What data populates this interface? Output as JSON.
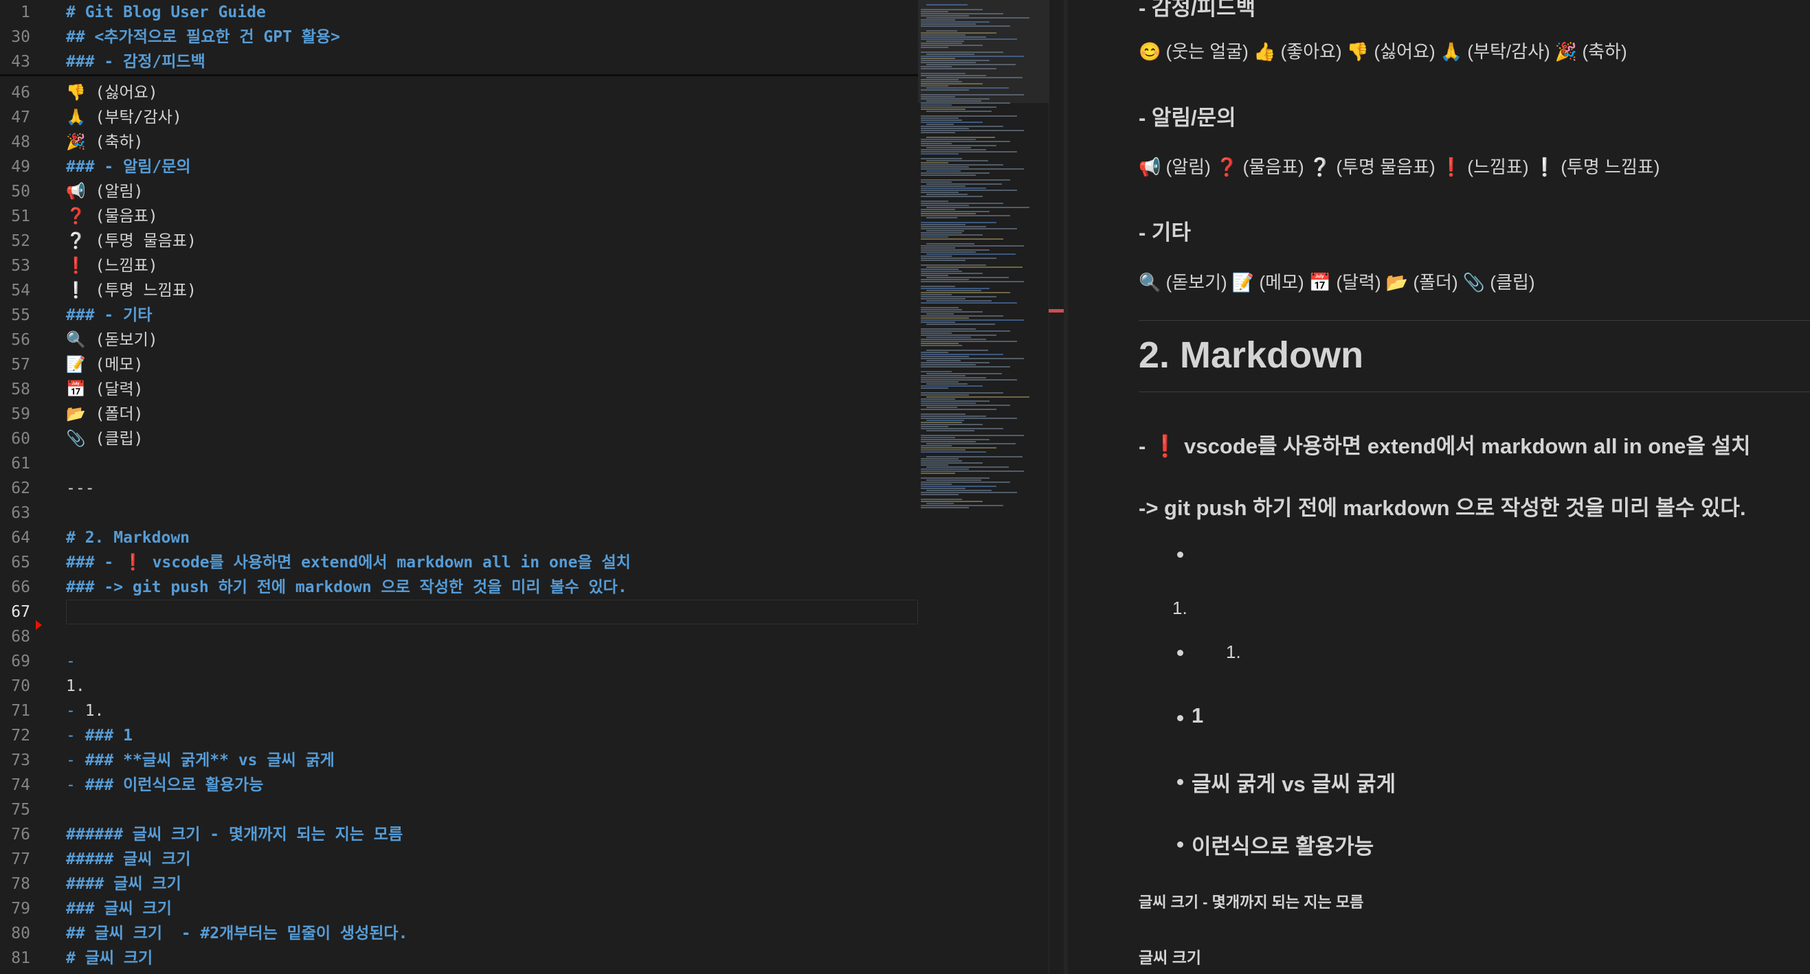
{
  "editor": {
    "sticky_lines": [
      {
        "num": "1",
        "text": "# Git Blog User Guide"
      },
      {
        "num": "30",
        "text": "## <추가적으로 필요한 건 GPT 활용>"
      },
      {
        "num": "43",
        "text": "### - 감정/피드백"
      }
    ],
    "lines": [
      {
        "num": "46",
        "text": "👎 (싫어요)",
        "style": "text"
      },
      {
        "num": "47",
        "text": "🙏 (부탁/감사)",
        "style": "text"
      },
      {
        "num": "48",
        "text": "🎉 (축하)",
        "style": "text"
      },
      {
        "num": "49",
        "text": "### - 알림/문의",
        "style": "heading"
      },
      {
        "num": "50",
        "text": "📢 (알림)",
        "style": "text"
      },
      {
        "num": "51",
        "text": "❓ (물음표)",
        "style": "text"
      },
      {
        "num": "52",
        "text": "❔ (투명 물음표)",
        "style": "text"
      },
      {
        "num": "53",
        "text": "❗ (느낌표)",
        "style": "text"
      },
      {
        "num": "54",
        "text": "❕ (투명 느낌표)",
        "style": "text"
      },
      {
        "num": "55",
        "text": "### - 기타",
        "style": "heading"
      },
      {
        "num": "56",
        "text": "🔍 (돋보기)",
        "style": "text"
      },
      {
        "num": "57",
        "text": "📝 (메모)",
        "style": "text"
      },
      {
        "num": "58",
        "text": "📅 (달력)",
        "style": "text"
      },
      {
        "num": "59",
        "text": "📂 (폴더)",
        "style": "text"
      },
      {
        "num": "60",
        "text": "📎 (클립)",
        "style": "text"
      },
      {
        "num": "61",
        "text": "",
        "style": "text"
      },
      {
        "num": "62",
        "text": "---",
        "style": "text"
      },
      {
        "num": "63",
        "text": "",
        "style": "text"
      },
      {
        "num": "64",
        "text": "# 2. Markdown",
        "style": "heading"
      },
      {
        "num": "65",
        "text": "### - ❗ vscode를 사용하면 extend에서 markdown all in one을 설치",
        "style": "heading"
      },
      {
        "num": "66",
        "text": "### -> git push 하기 전에 markdown 으로 작성한 것을 미리 볼수 있다.",
        "style": "heading"
      },
      {
        "num": "67",
        "text": "",
        "style": "text"
      },
      {
        "num": "68",
        "text": "",
        "style": "text"
      },
      {
        "num": "69",
        "text": "-",
        "style": "list"
      },
      {
        "num": "70",
        "text": "1.",
        "style": "text"
      },
      {
        "num": "71",
        "text": "- 1.",
        "style": "list"
      },
      {
        "num": "72",
        "text": "- ### 1",
        "style": "list"
      },
      {
        "num": "73",
        "text": "- ### **글씨 굵게** vs 글씨 굵게",
        "style": "list"
      },
      {
        "num": "74",
        "text": "- ### 이런식으로 활용가능",
        "style": "list"
      },
      {
        "num": "75",
        "text": "",
        "style": "text"
      },
      {
        "num": "76",
        "text": "###### 글씨 크기 - 몇개까지 되는 지는 모름",
        "style": "heading"
      },
      {
        "num": "77",
        "text": "##### 글씨 크기",
        "style": "heading"
      },
      {
        "num": "78",
        "text": "#### 글씨 크기",
        "style": "heading"
      },
      {
        "num": "79",
        "text": "### 글씨 크기",
        "style": "heading"
      },
      {
        "num": "80",
        "text": "## 글씨 크기  - #2개부터는 밑줄이 생성된다.",
        "style": "heading"
      },
      {
        "num": "81",
        "text": "# 글씨 크기",
        "style": "heading"
      }
    ],
    "active_line": "67"
  },
  "preview": {
    "partial_heading": "- 감정/피드백",
    "emotion_line": "😊 (웃는 얼굴) 👍 (좋아요) 👎 (싫어요) 🙏 (부탁/감사) 🎉 (축하)",
    "notice_heading": "- 알림/문의",
    "notice_line": "📢 (알림) ❓ (물음표) ❔ (투명 물음표) ❗ (느낌표) ❕ (투명 느낌표)",
    "etc_heading": "- 기타",
    "etc_line": "🔍 (돋보기) 📝 (메모) 📅 (달력) 📂 (폴더) 📎 (클립)",
    "h1": "2. Markdown",
    "h3_a_prefix": "- ",
    "h3_a_icon": "❗",
    "h3_a_text": " vscode를 사용하면 extend에서 markdown all in one을 설치",
    "h3_b": "-> git push 하기 전에 markdown 으로 작성한 것을 미리 볼수 있다.",
    "ol_item": "1.",
    "nested_ol_item": "1.",
    "list_h3_1": "1",
    "list_h3_2": "글씨 굵게 vs 글씨 굵게",
    "list_h3_3": "이런식으로 활용가능",
    "h6": "글씨 크기 - 몇개까지 되는 지는 모름",
    "h5": "글씨 크기"
  }
}
